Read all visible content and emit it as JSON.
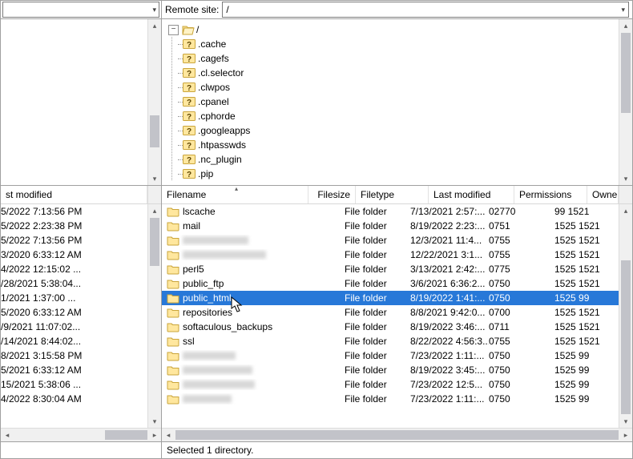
{
  "remote_site_label": "Remote site:",
  "remote_path": "/",
  "tree_root": "/",
  "tree_items": [
    ".cache",
    ".cagefs",
    ".cl.selector",
    ".clwpos",
    ".cpanel",
    ".cphorde",
    ".googleapps",
    ".htpasswds",
    ".nc_plugin",
    ".pip"
  ],
  "left_header": "st modified",
  "left_rows": [
    "5/2022 7:13:56 PM",
    "5/2022 2:23:38 PM",
    "5/2022 7:13:56 PM",
    "3/2020 6:33:12 AM",
    "4/2022 12:15:02 ...",
    "/28/2021 5:38:04...",
    "1/2021 1:37:00 ...",
    "5/2020 6:33:12 AM",
    "/9/2021 11:07:02...",
    "/14/2021 8:44:02...",
    "8/2021 3:15:58 PM",
    "5/2021 6:33:12 AM",
    "15/2021 5:38:06 ...",
    "4/2022 8:30:04 AM"
  ],
  "right_headers": {
    "filename": "Filename",
    "filesize": "Filesize",
    "filetype": "Filetype",
    "lastmod": "Last modified",
    "permissions": "Permissions",
    "owner": "Owner/Group"
  },
  "right_rows": [
    {
      "name": "lscache",
      "blur": false,
      "type": "File folder",
      "mod": "7/13/2021 2:57:...",
      "perm": "02770",
      "own": "99 1521"
    },
    {
      "name": "mail",
      "blur": false,
      "type": "File folder",
      "mod": "8/19/2022 2:23:...",
      "perm": "0751",
      "own": "1525 1521"
    },
    {
      "name": "",
      "blur": true,
      "type": "File folder",
      "mod": "12/3/2021 11:4...",
      "perm": "0755",
      "own": "1525 1521"
    },
    {
      "name": "",
      "blur": true,
      "type": "File folder",
      "mod": "12/22/2021 3:1...",
      "perm": "0755",
      "own": "1525 1521"
    },
    {
      "name": "perl5",
      "blur": false,
      "type": "File folder",
      "mod": "3/13/2021 2:42:...",
      "perm": "0775",
      "own": "1525 1521"
    },
    {
      "name": "public_ftp",
      "blur": false,
      "type": "File folder",
      "mod": "3/6/2021 6:36:2...",
      "perm": "0750",
      "own": "1525 1521"
    },
    {
      "name": "public_html",
      "blur": false,
      "selected": true,
      "type": "File folder",
      "mod": "8/19/2022 1:41:...",
      "perm": "0750",
      "own": "1525 99"
    },
    {
      "name": "repositories",
      "blur": false,
      "type": "File folder",
      "mod": "8/8/2021 9:42:0...",
      "perm": "0700",
      "own": "1525 1521"
    },
    {
      "name": "softaculous_backups",
      "blur": false,
      "type": "File folder",
      "mod": "8/19/2022 3:46:...",
      "perm": "0711",
      "own": "1525 1521"
    },
    {
      "name": "ssl",
      "blur": false,
      "type": "File folder",
      "mod": "8/22/2022 4:56:3...",
      "perm": "0755",
      "own": "1525 1521"
    },
    {
      "name": "",
      "blur": true,
      "type": "File folder",
      "mod": "7/23/2022 1:11:...",
      "perm": "0750",
      "own": "1525 99"
    },
    {
      "name": "",
      "blur": true,
      "type": "File folder",
      "mod": "8/19/2022 3:45:...",
      "perm": "0750",
      "own": "1525 99"
    },
    {
      "name": "",
      "blur": true,
      "type": "File folder",
      "mod": "7/23/2022 12:5...",
      "perm": "0750",
      "own": "1525 99"
    },
    {
      "name": "",
      "blur": true,
      "type": "File folder",
      "mod": "7/23/2022 1:11:...",
      "perm": "0750",
      "own": "1525 99"
    }
  ],
  "status_text": "Selected 1 directory."
}
